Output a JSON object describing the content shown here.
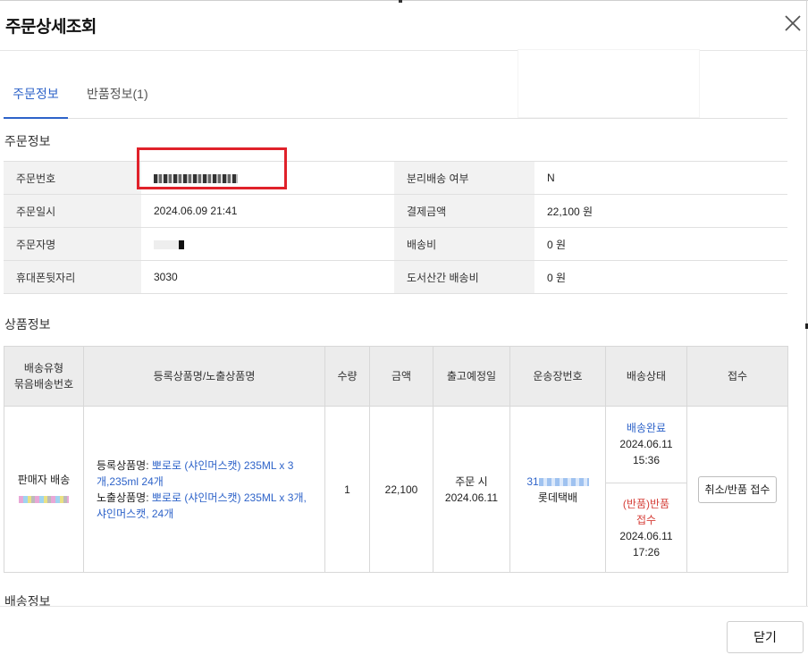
{
  "dialog": {
    "title": "주문상세조회"
  },
  "tabs": [
    {
      "label": "주문정보",
      "active": true
    },
    {
      "label": "반품정보(1)",
      "active": false
    }
  ],
  "order_section": {
    "title": "주문정보",
    "rows": [
      {
        "l1": "주문번호",
        "v1": "",
        "l2": "분리배송 여부",
        "v2": "N"
      },
      {
        "l1": "주문일시",
        "v1": "2024.06.09 21:41",
        "l2": "결제금액",
        "v2": "22,100 원"
      },
      {
        "l1": "주문자명",
        "v1": "",
        "l2": "배송비",
        "v2": "0 원"
      },
      {
        "l1": "휴대폰뒷자리",
        "v1": "3030",
        "l2": "도서산간 배송비",
        "v2": "0 원"
      }
    ]
  },
  "product_section": {
    "title": "상품정보",
    "headers": {
      "type_line1": "배송유형",
      "type_line2": "묶음배송번호",
      "name": "등록상품명/노출상품명",
      "qty": "수량",
      "amount": "금액",
      "ship_date": "출고예정일",
      "tracking": "운송장번호",
      "status": "배송상태",
      "receive": "접수"
    },
    "row": {
      "type": "판매자 배송",
      "reg_prefix": "등록상품명: ",
      "reg_name": "뽀로로 (샤인머스캣) 235ML x 3개,235ml 24개",
      "exp_prefix": "노출상품명: ",
      "exp_name": "뽀로로 (샤인머스캣) 235ML x 3개, 샤인머스캣, 24개",
      "qty": "1",
      "amount": "22,100",
      "ship_line1": "주문 시",
      "ship_line2": "2024.06.11",
      "tracking_prefix": "31",
      "carrier": "롯데택배",
      "status1": "배송완료",
      "status1_date": "2024.06.11",
      "status1_time": "15:36",
      "status2_tag": "(반품)",
      "status2": "반품",
      "status2_line2": "접수",
      "status2_date": "2024.06.11",
      "status2_time": "17:26",
      "receive_button": "취소/반품 접수"
    }
  },
  "shipping_section": {
    "title": "배송정보"
  },
  "footer": {
    "close_label": "닫기"
  },
  "colors": {
    "accent": "#2e63c9",
    "return_red": "#d6403a",
    "highlight": "#e0212a"
  }
}
